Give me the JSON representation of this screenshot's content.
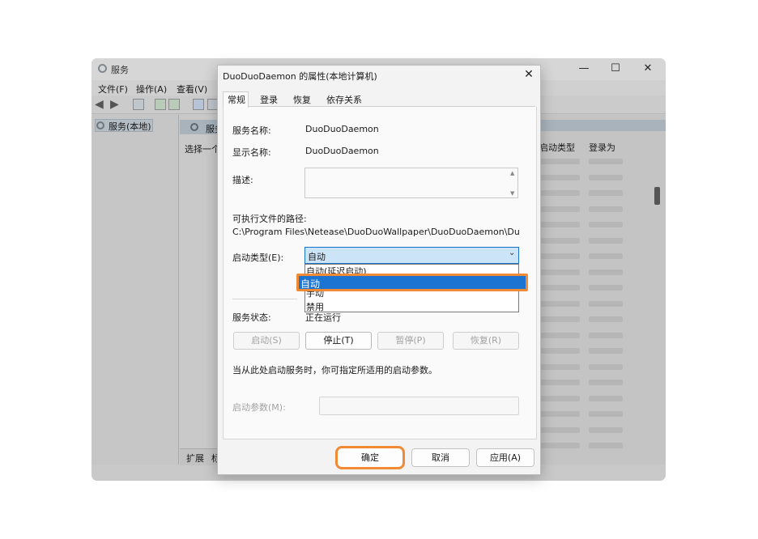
{
  "services_window": {
    "title": "服务",
    "menus": [
      "文件(F)",
      "操作(A)",
      "查看(V)"
    ],
    "tree_item": "服务(本地)",
    "mid_header": "服务",
    "mid_select_text": "选择一个",
    "columns": [
      "启动类型",
      "登录为"
    ],
    "bottom_tab": "扩展",
    "bottom_tab_2": "标",
    "controls": {
      "minimize": "—",
      "maximize": "☐",
      "close": "✕"
    }
  },
  "dialog": {
    "title": "DuoDuoDaemon 的属性(本地计算机)",
    "close": "✕",
    "tabs": [
      "常规",
      "登录",
      "恢复",
      "依存关系"
    ],
    "service_name_label": "服务名称:",
    "service_name": "DuoDuoDaemon",
    "display_name_label": "显示名称:",
    "display_name": "DuoDuoDaemon",
    "description_label": "描述:",
    "exe_path_label": "可执行文件的路径:",
    "exe_path": "C:\\Program Files\\Netease\\DuoDuoWallpaper\\DuoDuoDaemon\\DuoDuo",
    "startup_type_label": "启动类型(E):",
    "startup_type_value": "自动",
    "startup_options": [
      "自动(延迟启动)",
      "自动",
      "手动",
      "禁用"
    ],
    "startup_highlight": "自动",
    "status_label": "服务状态:",
    "status_value": "正在运行",
    "buttons": {
      "start": "启动(S)",
      "stop": "停止(T)",
      "pause": "暂停(P)",
      "resume": "恢复(R)"
    },
    "hint": "当从此处启动服务时，你可指定所适用的启动参数。",
    "param_label": "启动参数(M):",
    "footer": {
      "ok": "确定",
      "cancel": "取消",
      "apply": "应用(A)"
    }
  },
  "colors": {
    "highlight_orange": "#f08a35",
    "selection_blue": "#1b74d2"
  }
}
